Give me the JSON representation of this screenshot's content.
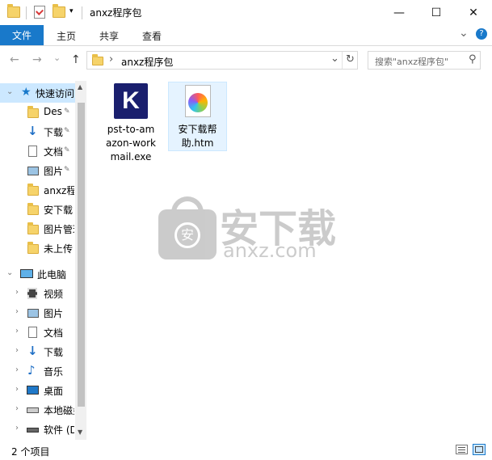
{
  "window": {
    "title": "anxz程序包",
    "minimize_glyph": "—",
    "maximize_glyph": "☐",
    "close_glyph": "✕"
  },
  "ribbon": {
    "tabs": [
      "文件",
      "主页",
      "共享",
      "查看"
    ],
    "expand_glyph": "⌄",
    "help_glyph": "?"
  },
  "address": {
    "path": "anxz程序包",
    "separator": "›",
    "dropdown_glyph": "⌄",
    "refresh_glyph": "↻"
  },
  "search": {
    "placeholder": "搜索\"anxz程序包\"",
    "icon_glyph": "⚲"
  },
  "nav": {
    "back_glyph": "←",
    "forward_glyph": "→",
    "recent_glyph": "⌄",
    "up_glyph": "↑",
    "quick_access": "快速访问",
    "quick_items": [
      {
        "label": "Des",
        "pinned": true
      },
      {
        "label": "下载",
        "pinned": true
      },
      {
        "label": "文档",
        "pinned": true
      },
      {
        "label": "图片",
        "pinned": true
      },
      {
        "label": "anxz程",
        "pinned": false
      },
      {
        "label": "安下载",
        "pinned": false
      },
      {
        "label": "图片管理",
        "pinned": false
      },
      {
        "label": "未上传",
        "pinned": false
      }
    ],
    "this_pc": "此电脑",
    "pc_items": [
      "视频",
      "图片",
      "文档",
      "下载",
      "音乐",
      "桌面",
      "本地磁盘",
      "软件 (D"
    ],
    "pin_glyph": "✎"
  },
  "files": [
    {
      "name_lines": [
        "pst-to-am",
        "azon-work",
        "mail.exe"
      ],
      "icon": "exe-k-icon",
      "selected": false
    },
    {
      "name_lines": [
        "安下载帮",
        "助.htm"
      ],
      "icon": "htm-photo-icon",
      "selected": true
    }
  ],
  "watermark": {
    "logo_text": "安",
    "title": "安下载",
    "subtitle": "anxz.com"
  },
  "status": {
    "count": "2 个项目"
  },
  "colors": {
    "accent": "#1979ca",
    "selection": "#e5f3ff",
    "folder": "#f6d36a"
  }
}
